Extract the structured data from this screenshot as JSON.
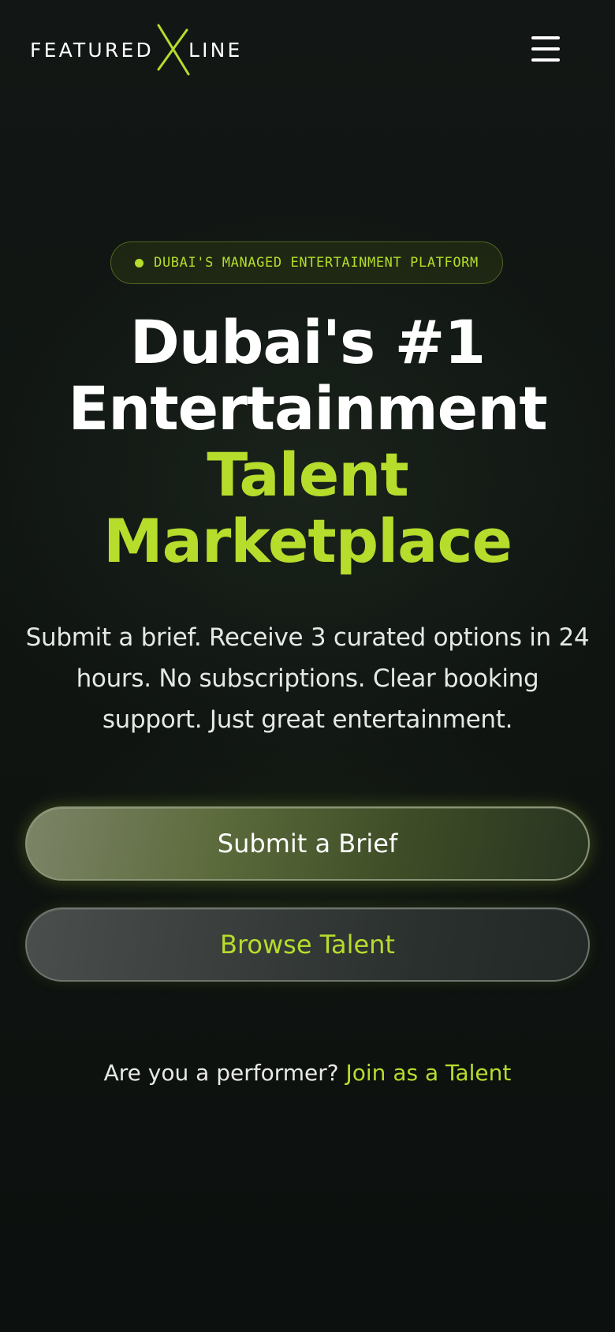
{
  "header": {
    "logo": {
      "left_text": "FEATURED",
      "right_text": "LINE"
    },
    "menu_icon": "hamburger-menu-icon"
  },
  "hero": {
    "badge": {
      "text": "DUBAI'S MANAGED ENTERTAINMENT PLATFORM"
    },
    "headline": {
      "line1": "Dubai's #1",
      "line2": "Entertainment",
      "line3": "Talent",
      "line4": "Marketplace"
    },
    "subtitle_lines": [
      "Submit a brief. Receive 3 curated options in 24",
      "hours. No subscriptions. Clear booking",
      "support. Just great entertainment."
    ],
    "primary_button": "Submit a Brief",
    "secondary_button": "Browse Talent",
    "performer_prompt": "Are you a performer?",
    "performer_link": "Join as a Talent"
  },
  "colors": {
    "accent": "#b6dc2c",
    "background": "#0c100e",
    "text": "#ffffff"
  }
}
